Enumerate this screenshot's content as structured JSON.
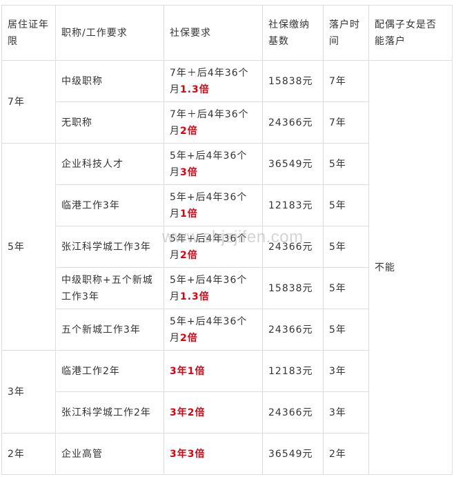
{
  "headers": [
    "居住证年限",
    "职称/工作要求",
    "社保要求",
    "社保缴纳基数",
    "落户时间",
    "配偶子女是否能落户"
  ],
  "spouse_value": "不能",
  "watermark": "www.shjzjifen.com",
  "rows": [
    {
      "years": "7年",
      "req": "中级职称",
      "ss_pre": "7年＋后4年36个月",
      "ss_hl": "1.3倍",
      "base": "15838元",
      "time": "7年"
    },
    {
      "req": "无职称",
      "ss_pre": "7年＋后4年36个月",
      "ss_hl": "2倍",
      "base": "24366元",
      "time": "7年"
    },
    {
      "years": "5年",
      "req": "企业科技人才",
      "ss_pre": "5年+后4年36个月",
      "ss_hl": "3倍",
      "base": "36549元",
      "time": "5年"
    },
    {
      "req": "临港工作3年",
      "ss_pre": "5年+后4年36个月",
      "ss_hl": "1倍",
      "base": "12183元",
      "time": "5年"
    },
    {
      "req": "张江科学城工作3年",
      "ss_pre": "5年+后4年36个月",
      "ss_hl": "2倍",
      "base": "24366元",
      "time": "5年"
    },
    {
      "req": "中级职称+五个新城工作3年",
      "ss_pre": "5年+后4年36个月",
      "ss_hl": "1.3倍",
      "base": "15838元",
      "time": "5年"
    },
    {
      "req": "五个新城工作3年",
      "ss_pre": "5年+后4年36个月",
      "ss_hl": "2倍",
      "base": "24366元",
      "time": "5年"
    },
    {
      "years": "3年",
      "req": "临港工作2年",
      "ss_pre": "",
      "ss_hl": "3年1倍",
      "base": "12183元",
      "time": "3年"
    },
    {
      "req": "张江科学城工作2年",
      "ss_pre": "",
      "ss_hl": "3年2倍",
      "base": "24366元",
      "time": "3年"
    },
    {
      "years": "2年",
      "req": "企业高管",
      "ss_pre": "",
      "ss_hl": "3年3倍",
      "base": "36549元",
      "time": "2年"
    }
  ]
}
